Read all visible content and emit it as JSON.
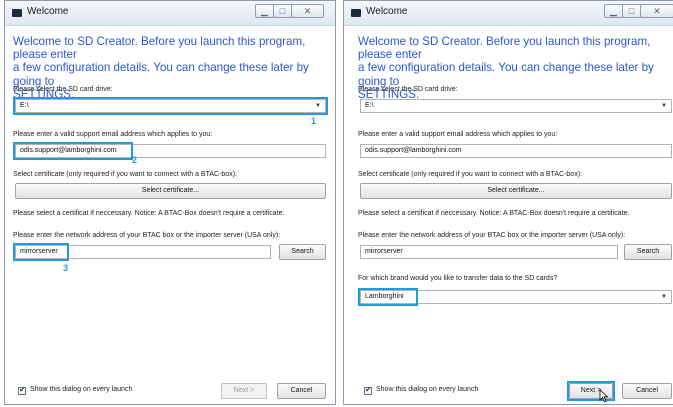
{
  "left": {
    "title": "Welcome",
    "heading": [
      "Welcome to SD Creator. Before you launch this program, please enter",
      "a few configuration details. You can change these later by going to",
      "SETTINGS."
    ],
    "drive_label": "Please select the SD card drive:",
    "drive_value": "E:\\",
    "email_label": "Please enter  a valid support email address which applies to you:",
    "email_value": "odis.support@lamborghini.com",
    "cert_label": "Select certificate (only required if you want to connect with a BTAC-box):",
    "cert_button": "Select certificate...",
    "cert_notice": "Please select a certificat if neccessary. Notice: A BTAC-Box doesn't require a certificate.",
    "network_label": "Please enter the network address of your BTAC box or the importer server (USA only):",
    "network_value": "mirrorserver",
    "search_button": "Search",
    "show_dialog": "Show this dialog on every launch",
    "next_button": "Next >",
    "cancel_button": "Cancel",
    "callouts": [
      "1",
      "2",
      "3"
    ]
  },
  "right": {
    "title": "Welcome",
    "heading": [
      "Welcome to SD Creator. Before you launch this program, please enter",
      "a few configuration details. You can change these later by going to",
      "SETTINGS."
    ],
    "drive_label": "Please select the SD card drive:",
    "drive_value": "E:\\",
    "email_label": "Please enter  a valid support email address which applies to you:",
    "email_value": "odis.support@lamborghini.com",
    "cert_label": "Select certificate (only required if you want to connect with a BTAC-box):",
    "cert_button": "Select certificate...",
    "cert_notice": "Please select a certificat if neccessary. Notice: A BTAC-Box doesn't require a certificate.",
    "network_label": "Please enter the network address of your BTAC box or the importer server (USA only):",
    "network_value": "mirrorserver",
    "search_button": "Search",
    "brand_label": "For which brand would you like to transfer data to the SD cards?",
    "brand_value": "Lamborghini",
    "show_dialog": "Show this dialog on every launch",
    "next_button": "Next >",
    "cancel_button": "Cancel"
  },
  "colors": {
    "heading": "#2a56d6",
    "highlight": "#1f9ae0"
  },
  "icons": {
    "minimize": "minimize-icon",
    "maximize": "maximize-icon",
    "close": "close-icon",
    "app": "app-icon",
    "dropdown": "chevron-down-icon",
    "checkbox": "checkmark-icon",
    "cursor": "mouse-cursor-icon"
  }
}
